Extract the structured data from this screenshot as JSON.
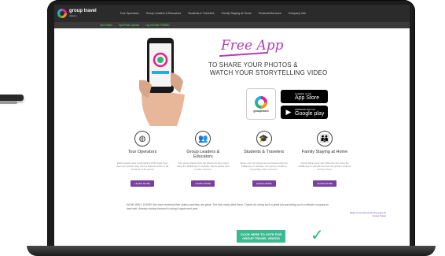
{
  "nav": {
    "logo_text": "group travel",
    "logo_sub": "videos",
    "items": [
      "Tour Operators",
      "Group Leaders & Educators",
      "Students & Travelers",
      "Family Staying at Home",
      "Products/Services",
      "Company Info"
    ]
  },
  "subnav": {
    "items": [
      "Tech Helps",
      "Tips/Photo Upload",
      "Log in/Order PROMO"
    ]
  },
  "hero": {
    "free_app": "Free App",
    "line1": "TO SHARE YOUR PHOTOS &",
    "line2": "WATCH YOUR STORYTELLING VIDEO",
    "gt_logo_text": "grouptravel",
    "appstore_small": "Available on the",
    "appstore_big": "App Store",
    "gplay_small": "ANDROID APP ON",
    "gplay_big": "Google play"
  },
  "features": [
    {
      "title": "Tour Operators",
      "text": "Each traveler gets a storytelling DVD made from their own photos; they send a featured video to all members of the group.",
      "button": "LEARN MORE",
      "icon": "globe-icon"
    },
    {
      "title": "Group Leaders & Educators",
      "text": "Your group shares their trip photos as they travel using the FREE app or website. Each traveler gets a video souvenir.",
      "button": "LEARN MORE",
      "icon": "group-icon"
    },
    {
      "title": "Students & Travelers",
      "text": "Share your trip photos as you travel using the FREE app or website. Your group creates a storytelling video souvenir.",
      "button": "LEARN MORE",
      "icon": "graduation-cap-icon"
    },
    {
      "title": "Family Staying at Home",
      "text": "Family back home can follow the trip using the FREE app or website and see the group's pictures as they travel.",
      "button": "LEARN MORE",
      "icon": "family-icon"
    }
  ],
  "testimonial": {
    "quote": "WOW! WELL DONE!! We have received their videos and they are great. The kids really liked them. Thanks for doing such a great job and being such a reliable company to deal with. Already looking forward to doing it again next year.",
    "side": "Read more Award-winning work by Group Travel"
  },
  "vote_button": "CLICK HERE TO VOTE FOR GROUP TRAVEL VIDEOS"
}
